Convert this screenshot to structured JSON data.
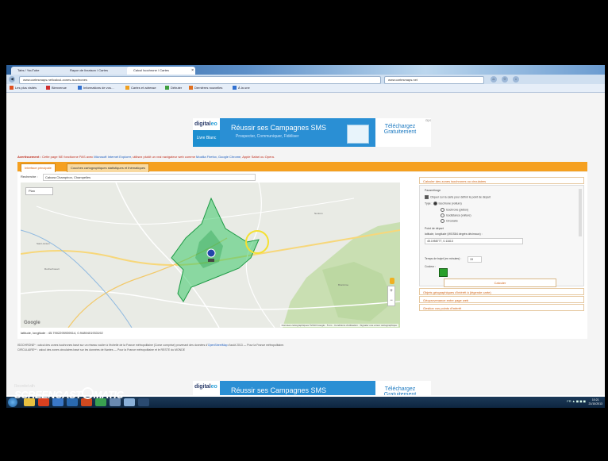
{
  "browser": {
    "tabs": [
      "Tabs / YouTube",
      "Rayon de livraison / Cartes",
      "Calcul Isochrone / Cartes"
    ],
    "url": "www.cartesmaps.net/calcul-zones-isochrones",
    "search": "www.cartesmaps.net",
    "bookmarks": [
      "Les plus visités",
      "Bienvenue",
      "Informations de vos…",
      "Cartes et adresse",
      "Débuter",
      "Dernières nouvelles",
      "À la une"
    ]
  },
  "ad": {
    "brand_a": "digital",
    "brand_b": "eo",
    "book": "Livre Blanc",
    "headline": "Réussir ses Campagnes SMS",
    "subline": "Prospecter, Communiquer, Fidéliser",
    "cta_line1": "Téléchargez",
    "cta_line2": "Gratuitement",
    "tag": "D|X"
  },
  "warning": {
    "bold": "Avertissement :",
    "text": " Cette page NE fonctionne PAS avec ",
    "browser": "Microsoft Internet Explorer",
    "text2": ", utilisez plutôt un vrai navigateur web comme ",
    "alts": "Mozilla Firefox, Google Chrome",
    "text3": ", Apple Safari ou Opera."
  },
  "page_tabs": {
    "main": "Interface principale",
    "layers": "Couches cartographiques statistiques et thématiques"
  },
  "search": {
    "label": "Recherche :",
    "value": "Cabara Champiron, Champelles"
  },
  "map": {
    "type": "Plan",
    "zoom_in": "+",
    "zoom_out": "−",
    "google": "Google",
    "footer": "Données cartographiques ©2013 Google · 5 km · Conditions d'utilisation · Signaler une erreur cartographique",
    "coords_label": "latitude, longitude :",
    "coords_value": "45.7902295939514, 0.9489401933192",
    "polygon_fill": "#3cc86a",
    "polygon_stroke": "#1e9a45"
  },
  "panel": {
    "title": "Calculer des zones isochrones ou circulaires",
    "settings": "Paramétrage",
    "opt_center": "Cliquer sur la carte pour définir le point de départ",
    "type_label": "Type :",
    "opt_car": "Isochrone (voiture)",
    "opt_isochrone_foot": "Isochrone (piéton)",
    "opt_isodistance": "Isodistance (voiture)",
    "opt_circle": "Circulaire",
    "depart_label": "Point de départ",
    "depart_coords_label": "latitude, longitude (WGS84 degrés décimaux) :",
    "depart_value": "45.1958777, 0.11613",
    "time_label": "Temps de trajet (en minutes) :",
    "time_value": "15",
    "color_label": "Couleur :",
    "color": "#2aa02a",
    "calc": "Calculer",
    "section2": "Objets géographiques d'intérêt à (légende carte)",
    "section3": "Géoprovenance entre page web",
    "section4": "Gestion vos points d'intérêt"
  },
  "footnote": {
    "line1": "ISOCHRONE* : calcul des zones isochrones basé sur un réseau routier à l'échelle de la France métropolitaine (Corse comprise) provenant des données d'",
    "osm": "OpenStreetMap",
    "line1b": " d'août 2013 — Pour la France métropolitaine.",
    "line2": "CIRCULAIRE** : calcul des zones circulaires basé sur les données de Nantes — Pour la France métropolitaine et le RESTE du MONDE"
  },
  "taskbar": {
    "tray": "FR ▲ ◼ ◼ ◼",
    "time": "10:21",
    "date": "21/10/2013"
  },
  "watermark": {
    "recorded": "Recorded with",
    "brand": "SCREENCAST",
    "brand2": "MATIC"
  }
}
